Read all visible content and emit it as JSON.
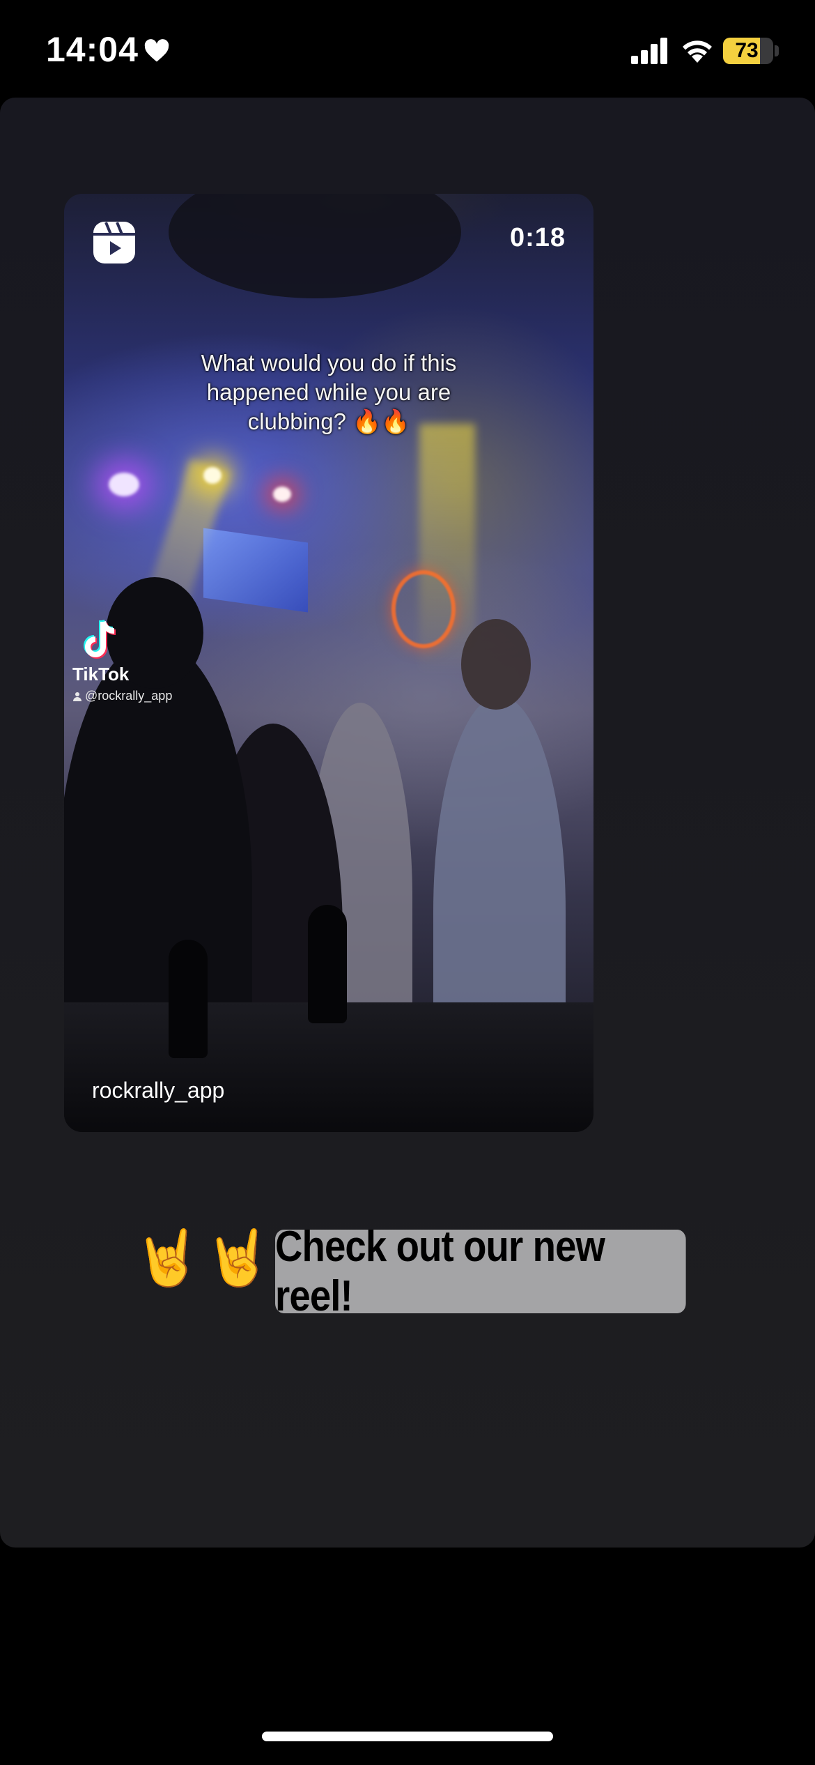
{
  "status_bar": {
    "time": "14:04",
    "battery_level": "73",
    "battery_fraction": 0.73,
    "icons": [
      "heart-icon",
      "signal-icon",
      "wifi-icon",
      "battery-icon"
    ]
  },
  "reel": {
    "duration": "0:18",
    "caption": "What would you do if this happened while you are clubbing? 🔥🔥",
    "tiktok_label": "TikTok",
    "tiktok_handle": "@rockrally_app",
    "username": "rockrally_app",
    "icon": "reels-icon"
  },
  "story": {
    "emojis": "🤘🤘",
    "sticker_text": "Check out our new reel!",
    "sticker_color": "#a4a4a6"
  }
}
